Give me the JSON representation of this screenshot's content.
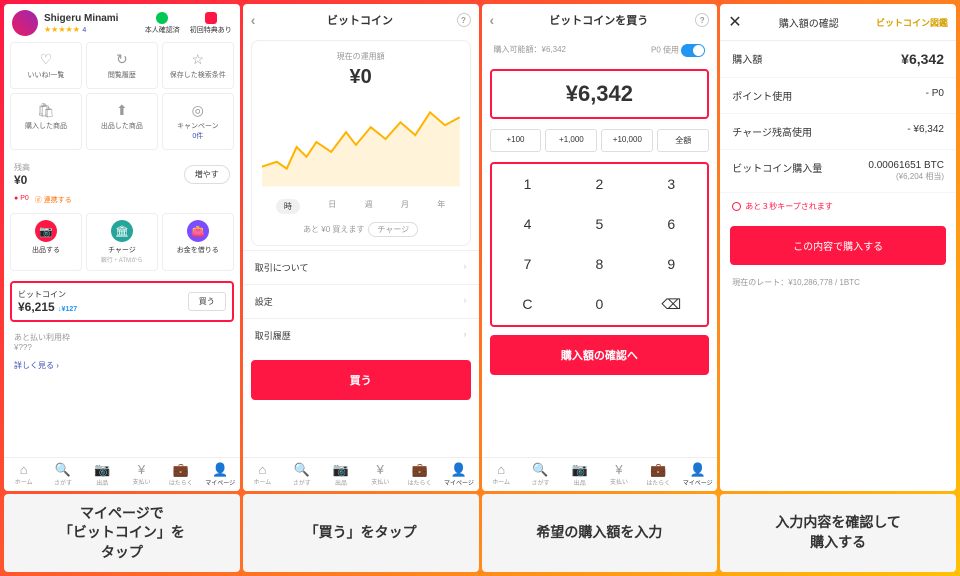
{
  "s1": {
    "user": "Shigeru Minami",
    "rating": "★★★★★",
    "ratingCount": "4",
    "badge1": "本人確認済",
    "badge2": "初回特典あり",
    "tiles": [
      "いいね!一覧",
      "閲覧履歴",
      "保存した検索条件",
      "購入した商品",
      "出品した商品",
      "キャンペーン"
    ],
    "tilesSub": "0件",
    "balLabel": "残高",
    "balAmt": "¥0",
    "growBtn": "増やす",
    "pt1": "P0",
    "pt2": "連携する",
    "act1": "出品する",
    "act2": "チャージ",
    "act2s": "銀行・ATMから",
    "act3": "お金を借りる",
    "btcLabel": "ビットコイン",
    "btcAmt": "¥6,215",
    "btcChg": "↓¥127",
    "buyBtn": "買う",
    "laterLabel": "あと払い利用枠",
    "laterAmt": "¥???",
    "more": "詳しく見る"
  },
  "s2": {
    "title": "ビットコイン",
    "cardTitle": "現在の運用額",
    "amt": "¥0",
    "periods": [
      "時",
      "日",
      "週",
      "月",
      "年"
    ],
    "chg": "あと ¥0 買えます",
    "chgBtn": "チャージ",
    "l1": "取引について",
    "l2": "設定",
    "l3": "取引履歴",
    "btn": "買う"
  },
  "s3": {
    "title": "ビットコインを買う",
    "avail": "購入可能額：¥6,342",
    "poLabel": "P0 使用",
    "amt": "¥6,342",
    "chips": [
      "+100",
      "+1,000",
      "+10,000",
      "全額"
    ],
    "keys": [
      [
        "1",
        "2",
        "3"
      ],
      [
        "4",
        "5",
        "6"
      ],
      [
        "7",
        "8",
        "9"
      ],
      [
        "C",
        "0",
        "⌫"
      ]
    ],
    "btn": "購入額の確認へ"
  },
  "s4": {
    "title": "購入額の確認",
    "logo": "ビットコイン図鑑",
    "r1l": "購入額",
    "r1v": "¥6,342",
    "r2l": "ポイント使用",
    "r2v": "- P0",
    "r3l": "チャージ残高使用",
    "r3v": "- ¥6,342",
    "r4l": "ビットコイン購入量",
    "r4v": "0.00061651 BTC",
    "r4s": "(¥6,204 相当)",
    "keep": "あと３秒キープされます",
    "btn": "この内容で購入する",
    "rate": "現在のレート：¥10,286,778 / 1BTC"
  },
  "nav": [
    "ホーム",
    "さがす",
    "出品",
    "支払い",
    "はたらく",
    "マイページ"
  ],
  "cap": [
    "マイページで\n「ビットコイン」を\nタップ",
    "「買う」をタップ",
    "希望の購入額を入力",
    "入力内容を確認して\n購入する"
  ]
}
